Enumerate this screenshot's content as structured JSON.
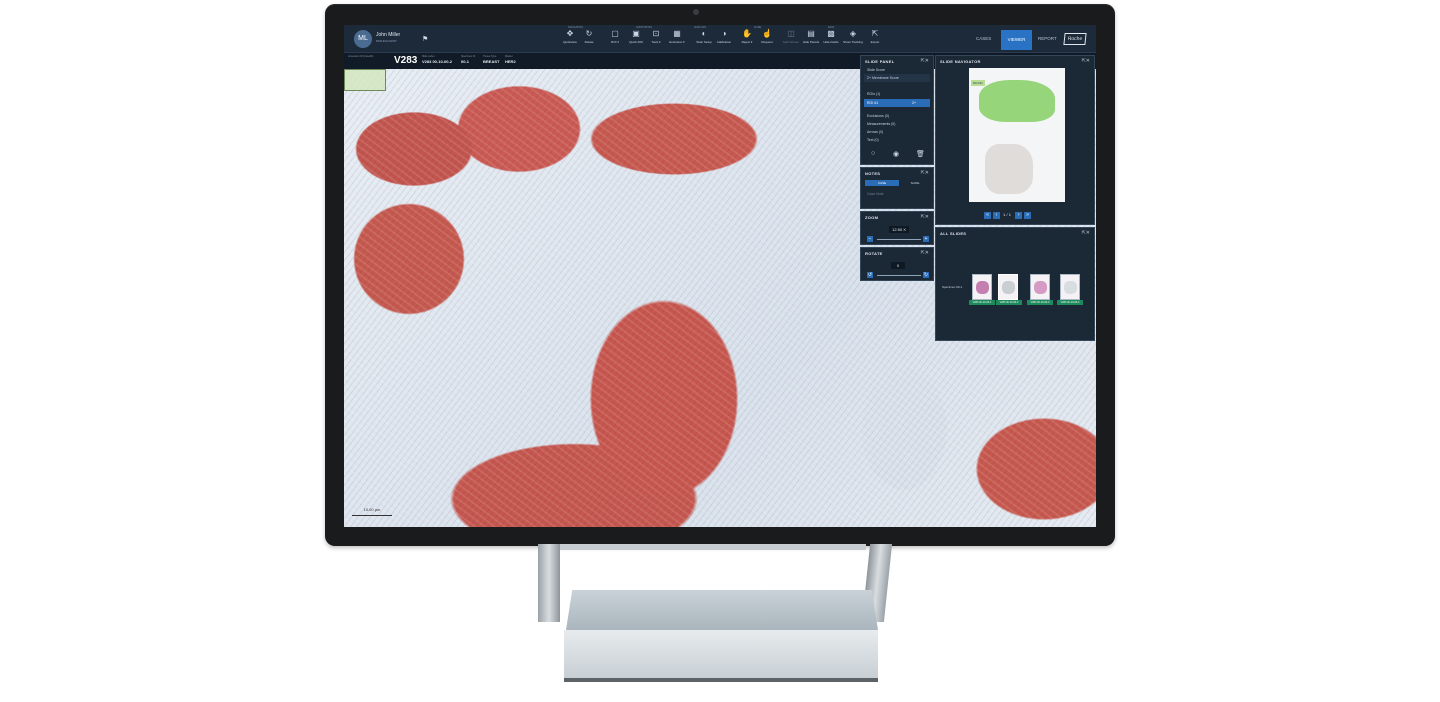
{
  "user": {
    "initials": "ML",
    "name": "John Miller",
    "role": "PATHOLOGIST"
  },
  "toolbar": {
    "groups": [
      "NAVIGATION",
      "ANNOTATION",
      "ANALYSIS",
      "SLIDE",
      "DATA"
    ],
    "tools": [
      {
        "label": "Quickview",
        "icon": "move-icon"
      },
      {
        "label": "Rotate",
        "icon": "rotate-icon"
      },
      {
        "label": "ROI ▾",
        "icon": "square-icon"
      },
      {
        "label": "Quick ROI",
        "icon": "roi-icon"
      },
      {
        "label": "Tools ▾",
        "icon": "tools-icon"
      },
      {
        "label": "Exclusion ▾",
        "icon": "exclusion-icon"
      },
      {
        "label": "Stain Setup",
        "icon": "stain-icon"
      },
      {
        "label": "Calibration",
        "icon": "calibration-icon"
      },
      {
        "label": "Reject ▾",
        "icon": "reject-icon"
      },
      {
        "label": "Request",
        "icon": "request-icon"
      },
      {
        "label": "Split Screen",
        "icon": "split-icon"
      },
      {
        "label": "Hide Panels",
        "icon": "panels-icon"
      },
      {
        "label": "Hide Fields",
        "icon": "fields-icon"
      },
      {
        "label": "Show Tracking",
        "icon": "tracking-icon"
      },
      {
        "label": "Export",
        "icon": "export-icon"
      }
    ]
  },
  "nav": {
    "cases": "CASES",
    "viewer": "VIEWER",
    "report": "REPORT",
    "brand": "Roche"
  },
  "case": {
    "accession_label": "Accession ID (CaseID)",
    "accession_id": "V283",
    "slide_label_label": "Slide Label",
    "slide_label": "V283 00-10-00-2",
    "specimen_label": "Specimen ID",
    "specimen": "00-1",
    "tissue_label": "Tissue Type",
    "tissue": "BREAST",
    "marker_label": "Marker",
    "marker": "HER2"
  },
  "viewer": {
    "scale_label": "10.00 µm"
  },
  "slide_panel": {
    "title": "SLIDE PANEL",
    "score_label": "Slide Score",
    "score_value": "2+ Membrane Score",
    "rois_label": "ROIs (1)",
    "roi_name": "ROI #1",
    "roi_score": "2+",
    "sections": [
      "Exclusions (0)",
      "Measurements (0)",
      "Arrows (0)",
      "Text (0)"
    ]
  },
  "notes_panel": {
    "title": "NOTES",
    "tab_case": "CASE",
    "tab_slide": "SLIDE",
    "placeholder": "Case Note"
  },
  "zoom_panel": {
    "title": "ZOOM",
    "value": "12.50",
    "unit": "X"
  },
  "rotate_panel": {
    "title": "ROTATE",
    "value": "0"
  },
  "navigator": {
    "title": "SLIDE NAVIGATOR",
    "roi_tag": "ROI #1",
    "page": "1",
    "total": "1"
  },
  "all_slides": {
    "title": "ALL SLIDES",
    "specimen": "Specimen 00-1",
    "slides": [
      "V283 00-10-00-1",
      "V283 00-10-00-2",
      "V283 00-10-00-3",
      "V283 00-10-00-4"
    ]
  }
}
